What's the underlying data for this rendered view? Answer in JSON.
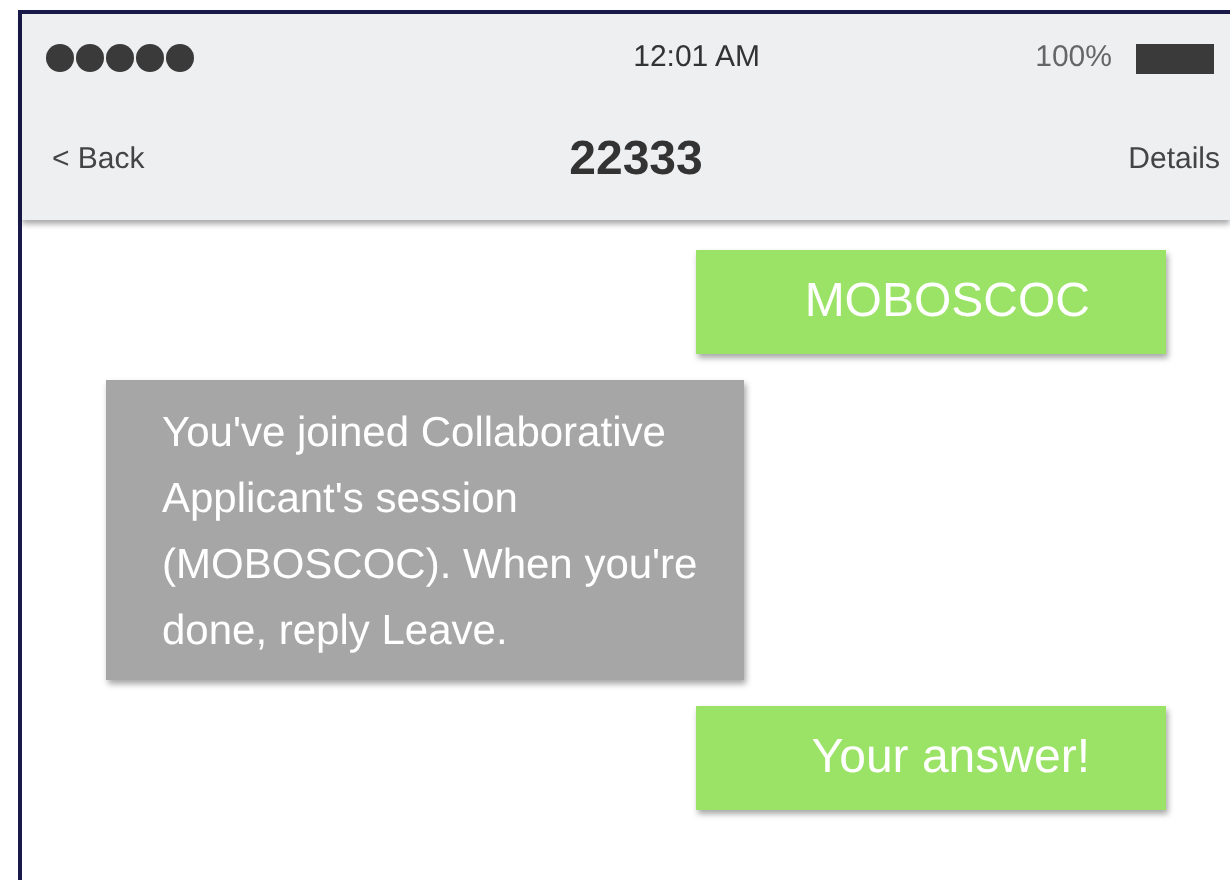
{
  "status_bar": {
    "time": "12:01 AM",
    "battery_text": "100%"
  },
  "nav_bar": {
    "back": "< Back",
    "title": "22333",
    "action": "Details"
  },
  "messages": [
    {
      "kind": "sent",
      "text": "MOBOSCOC"
    },
    {
      "kind": "received",
      "text": "You've joined Collaborative Applicant's session (MOBOSCOC). When you're done, reply Leave."
    },
    {
      "kind": "sent",
      "text": "Your answer!"
    }
  ]
}
